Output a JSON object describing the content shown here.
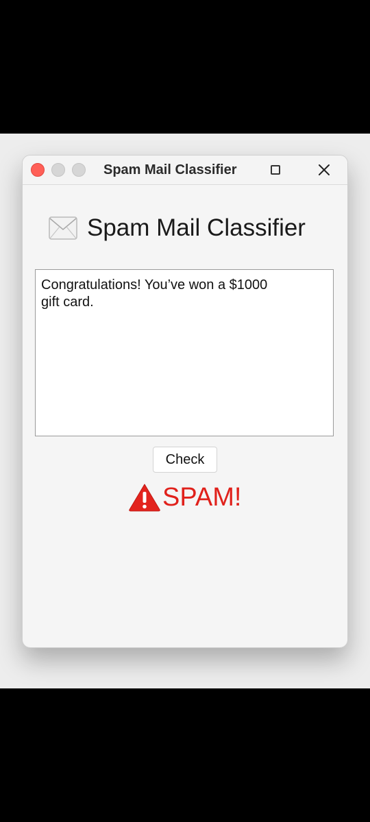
{
  "window": {
    "title": "Spam Mail Classifier"
  },
  "app": {
    "heading": "Spam Mail Classifier",
    "heading_icon": "envelope-icon"
  },
  "message_input": {
    "lines": [
      "Congratulations! You’ve won a $1000",
      "gift card."
    ]
  },
  "check_button": {
    "label": "Check"
  },
  "result": {
    "icon": "warning-icon",
    "text": "SPAM!",
    "color": "#e0211b"
  },
  "colors": {
    "close_light": "#ff5f57",
    "inactive_light": "#d6d6d6",
    "window_bg": "#f5f5f5"
  }
}
